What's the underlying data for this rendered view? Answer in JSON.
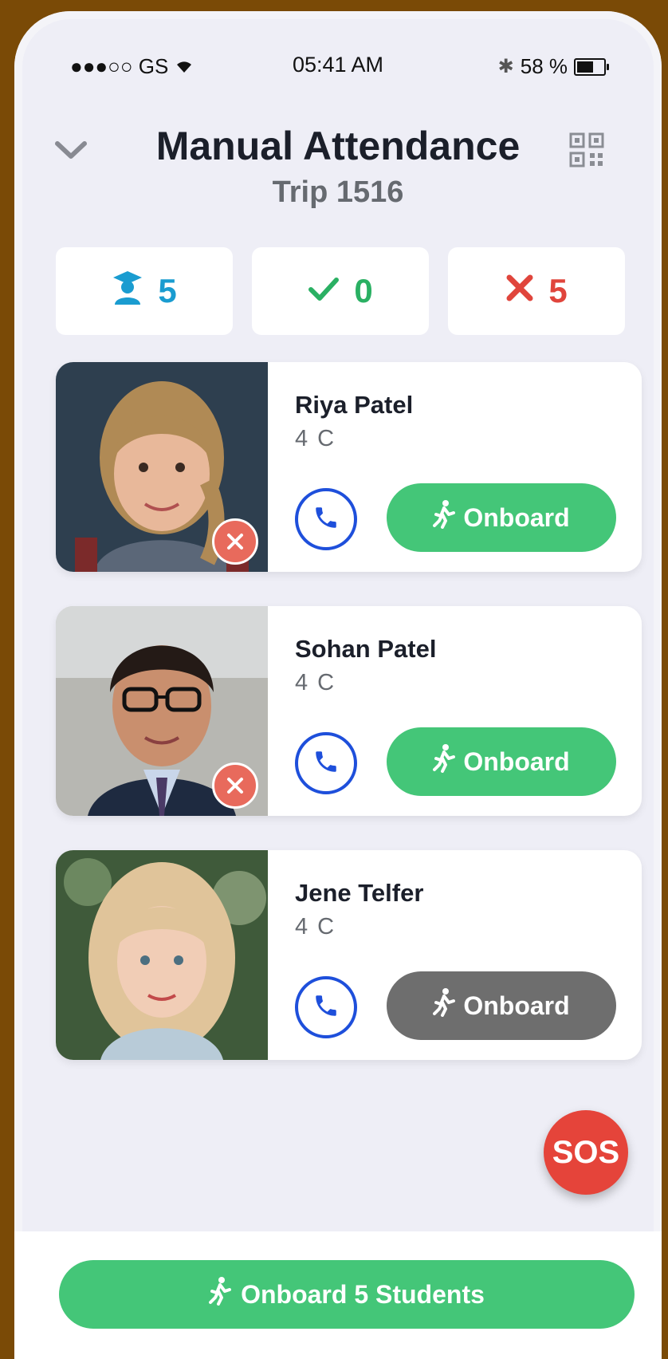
{
  "status_bar": {
    "signal": "●●●○○ GS",
    "time": "05:41 AM",
    "battery": "58 %"
  },
  "header": {
    "title": "Manual Attendance",
    "subtitle": "Trip 1516"
  },
  "stats": {
    "total": "5",
    "onboard": "0",
    "absent": "5"
  },
  "students": [
    {
      "name": "Riya Patel",
      "grade": "4 C",
      "action": "Onboard"
    },
    {
      "name": "Sohan Patel",
      "grade": "4 C",
      "action": "Onboard"
    },
    {
      "name": "Jene Telfer",
      "grade": "4 C",
      "action": "Onboard"
    }
  ],
  "sos_label": "SOS",
  "footer": {
    "button_label": "Onboard 5 Students"
  },
  "colors": {
    "primary_green": "#44c678",
    "blue": "#1e4fdb",
    "red": "#e5443a",
    "gray": "#6e6e6e"
  }
}
